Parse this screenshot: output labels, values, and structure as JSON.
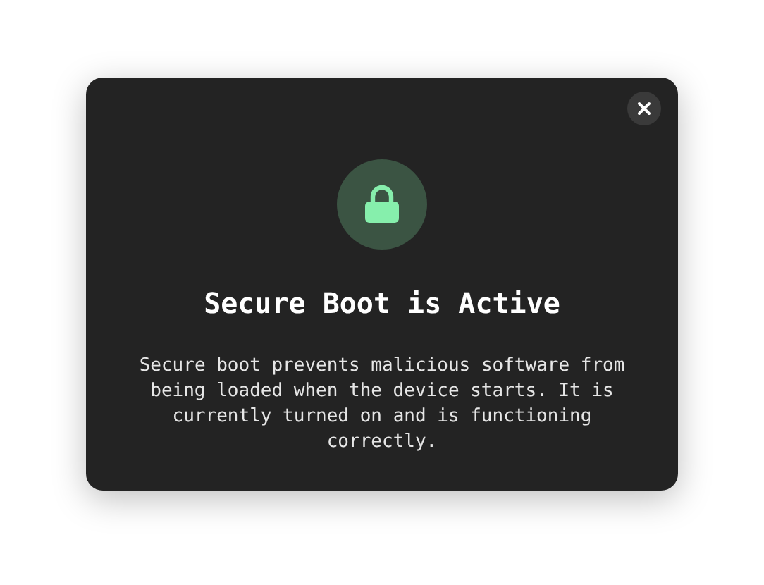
{
  "dialog": {
    "title": "Secure Boot is Active",
    "description": "Secure boot prevents malicious software from being loaded when the device starts. It is currently turned on and is functioning correctly."
  }
}
